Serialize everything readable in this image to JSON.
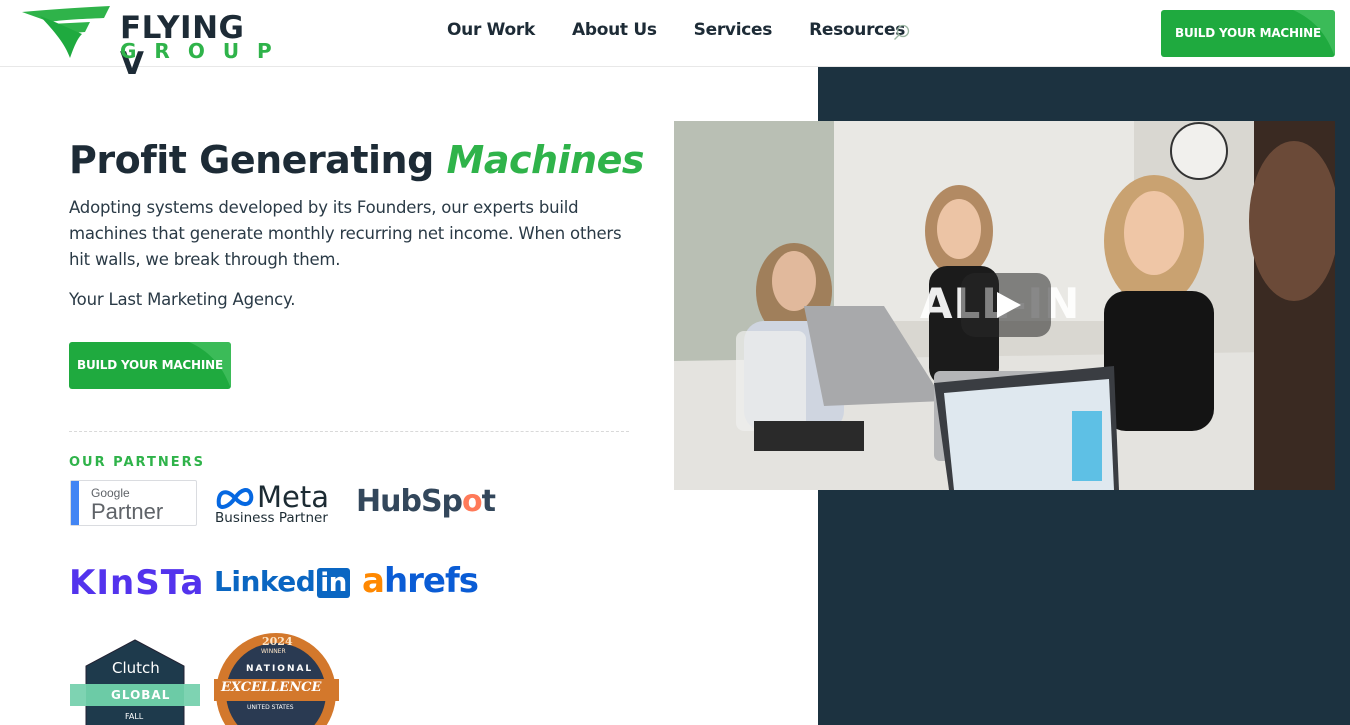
{
  "header": {
    "logo_line1": "FLYING V",
    "logo_line2": "GROUP",
    "nav": [
      "Our Work",
      "About Us",
      "Services",
      "Resources"
    ],
    "cta_label": "BUILD YOUR MACHINE"
  },
  "hero": {
    "title_main": "Profit Generating",
    "title_accent": "Machines",
    "body": "Adopting systems developed by its Founders, our experts build machines that generate monthly recurring net income. When others hit walls, we break through them.",
    "tagline": "Your Last Marketing Agency.",
    "cta_label": "BUILD YOUR MACHINE"
  },
  "partners": {
    "label": "OUR PARTNERS",
    "google": {
      "line1": "Google",
      "line2": "Partner"
    },
    "meta": {
      "line1": "Meta",
      "line2": "Business Partner"
    },
    "hubspot": {
      "pre": "HubSp",
      "dot": "o",
      "post": "t"
    },
    "kinsta": "KInSTa",
    "linkedin": {
      "word": "Linked",
      "box": "in"
    },
    "ahrefs": {
      "a": "a",
      "rest": "hrefs"
    },
    "clutch": {
      "name": "Clutch",
      "band": "GLOBAL",
      "season": "FALL"
    },
    "national": {
      "year": "2024",
      "winner": "WINNER",
      "line1": "NATIONAL",
      "line2": "EXCELLENCE",
      "line3": "UNITED STATES"
    }
  },
  "video": {
    "title": "ALL-IN"
  },
  "colors": {
    "brand_green": "#2fb34a",
    "button_green": "#1faa3f",
    "navy": "#1d2b36",
    "dark_panel": "#1c3240"
  }
}
